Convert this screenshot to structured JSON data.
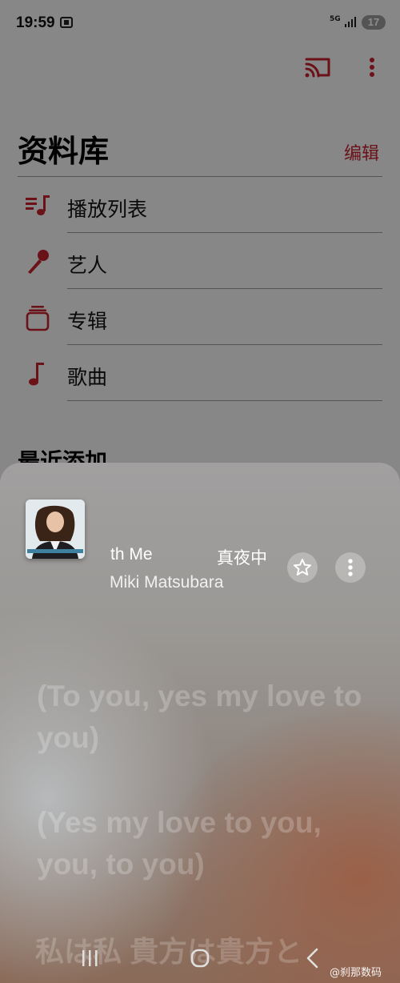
{
  "status_bar": {
    "time": "19:59",
    "network": "5G",
    "battery": "17"
  },
  "library": {
    "title": "资料库",
    "edit": "编辑",
    "items": [
      {
        "label": "播放列表",
        "icon": "playlist-icon"
      },
      {
        "label": "艺人",
        "icon": "microphone-icon"
      },
      {
        "label": "专辑",
        "icon": "album-stack-icon"
      },
      {
        "label": "歌曲",
        "icon": "music-note-icon"
      }
    ],
    "recent_title": "最近添加"
  },
  "now_playing": {
    "title_visible_a": "th Me",
    "title_visible_b": "真夜中",
    "artist": "Miki Matsubara",
    "lyrics": [
      "(To you, yes my love to you)",
      "(Yes my love to you, you, to you)",
      "私は私 貴方は貴方と"
    ]
  },
  "watermark": "@刹那数码",
  "colors": {
    "accent": "#c4222e"
  }
}
